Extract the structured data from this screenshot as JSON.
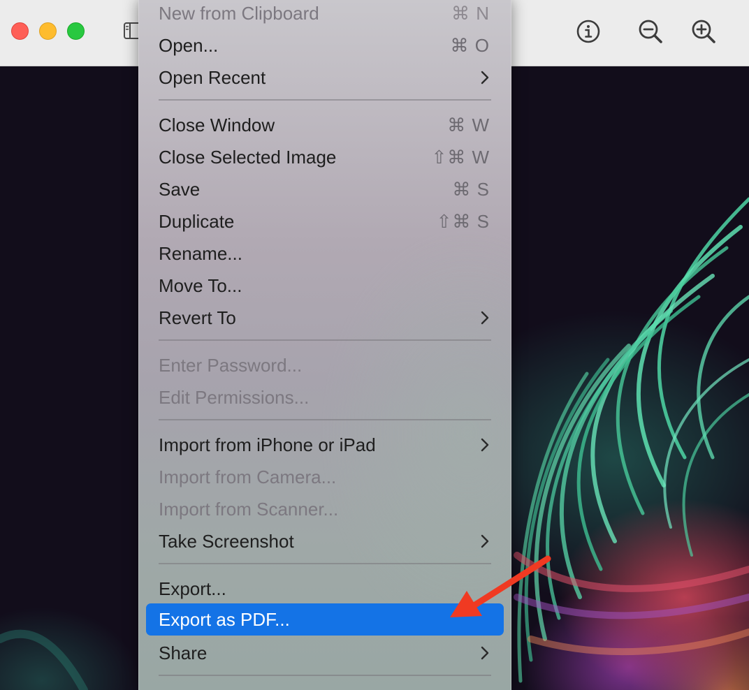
{
  "window": {
    "traffic_lights": [
      "close",
      "minimize",
      "zoom"
    ],
    "toolbar_icons": [
      "sidebar-toggle-icon",
      "info-icon",
      "zoom-out-icon",
      "zoom-in-icon"
    ]
  },
  "menu": {
    "items": [
      {
        "label": "New from Clipboard",
        "shortcut": "⌘ N",
        "disabled": true
      },
      {
        "label": "Open...",
        "shortcut": "⌘ O"
      },
      {
        "label": "Open Recent",
        "submenu": true
      },
      {
        "label": "Close Window",
        "shortcut": "⌘ W"
      },
      {
        "label": "Close Selected Image",
        "shortcut": "⇧⌘ W"
      },
      {
        "label": "Save",
        "shortcut": "⌘ S"
      },
      {
        "label": "Duplicate",
        "shortcut": "⇧⌘ S"
      },
      {
        "label": "Rename..."
      },
      {
        "label": "Move To..."
      },
      {
        "label": "Revert To",
        "submenu": true
      },
      {
        "label": "Enter Password...",
        "disabled": true
      },
      {
        "label": "Edit Permissions...",
        "disabled": true
      },
      {
        "label": "Import from iPhone or iPad",
        "submenu": true
      },
      {
        "label": "Import from Camera...",
        "disabled": true
      },
      {
        "label": "Import from Scanner...",
        "disabled": true
      },
      {
        "label": "Take Screenshot",
        "submenu": true
      },
      {
        "label": "Export..."
      },
      {
        "label": "Export as PDF...",
        "selected": true
      },
      {
        "label": "Share",
        "submenu": true
      }
    ]
  },
  "colors": {
    "selection": "#1473e6",
    "annotation_arrow": "#f03a22"
  }
}
